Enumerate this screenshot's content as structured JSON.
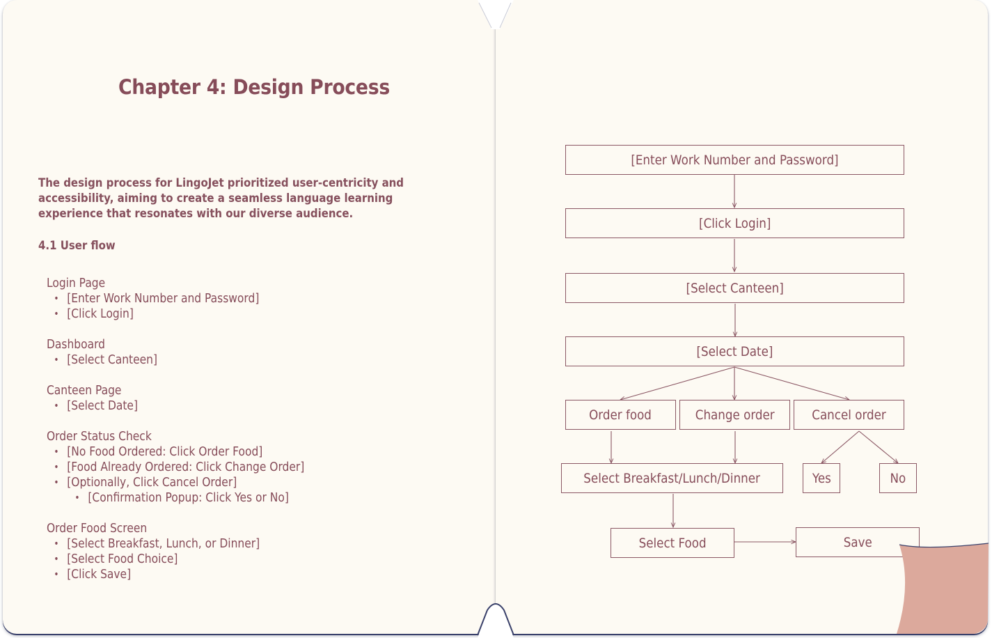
{
  "chapter_title": "Chapter 4: Design Process",
  "intro": "The design process for LingoJet prioritized user-centricity and accessibility, aiming to create a seamless language learning experience that resonates with our diverse audience.",
  "section_heading": "4.1 User flow",
  "flow": [
    {
      "title": "Login Page",
      "steps": [
        "[Enter Work Number and Password]",
        "[Click Login]"
      ]
    },
    {
      "title": "Dashboard",
      "steps": [
        "[Select Canteen]"
      ]
    },
    {
      "title": "Canteen Page",
      "steps": [
        "[Select Date]"
      ]
    },
    {
      "title": "Order Status Check",
      "steps": [
        "[No Food Ordered: Click Order Food]",
        "[Food Already Ordered: Click Change Order]",
        "[Optionally, Click Cancel Order]"
      ],
      "sub_steps": [
        "[Confirmation Popup: Click Yes or No]"
      ]
    },
    {
      "title": "Order Food Screen",
      "steps": [
        "[Select Breakfast, Lunch, or Dinner]",
        "[Select Food Choice]",
        "[Click Save]"
      ]
    }
  ],
  "diagram": {
    "nodes": {
      "enter_credentials": "[Enter Work Number and Password]",
      "click_login": "[Click Login]",
      "select_canteen": "[Select Canteen]",
      "select_date": "[Select Date]",
      "order_food": "Order food",
      "change_order": "Change order",
      "cancel_order": "Cancel order",
      "select_meal": "Select Breakfast/Lunch/Dinner",
      "yes": "Yes",
      "no": "No",
      "select_food": "Select Food",
      "save": "Save"
    },
    "line_color": "#8a5663"
  },
  "colors": {
    "page": "#fdfaf3",
    "text": "#864c59",
    "page_curl": "#dca99c",
    "binding_shadow": "#39406a"
  }
}
